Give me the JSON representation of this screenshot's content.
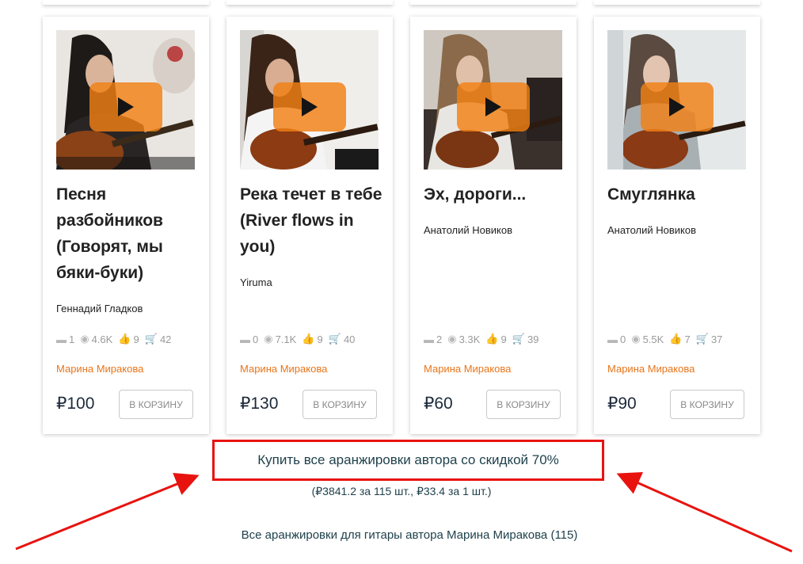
{
  "colors": {
    "accent_orange": "#e8751a",
    "play_overlay": "#f28014",
    "highlight_red": "#e8130f",
    "dark_text": "#1d3f4a"
  },
  "cards": [
    {
      "title": "Песня разбойников (Говорят, мы бяки-буки)",
      "author": "Геннадий Гладков",
      "comments": "1",
      "views": "4.6K",
      "likes": "9",
      "purchases": "42",
      "arranger": "Марина Миракова",
      "price": "₽100",
      "cart_label": "В КОРЗИНУ"
    },
    {
      "title": "Река течет в тебе (River flows in you)",
      "author": "Yiruma",
      "comments": "0",
      "views": "7.1K",
      "likes": "9",
      "purchases": "40",
      "arranger": "Марина Миракова",
      "price": "₽130",
      "cart_label": "В КОРЗИНУ"
    },
    {
      "title": "Эх, дороги...",
      "author": "Анатолий Новиков",
      "comments": "2",
      "views": "3.3K",
      "likes": "9",
      "purchases": "39",
      "arranger": "Марина Миракова",
      "price": "₽60",
      "cart_label": "В КОРЗИНУ"
    },
    {
      "title": "Смуглянка",
      "author": "Анатолий Новиков",
      "comments": "0",
      "views": "5.5K",
      "likes": "7",
      "purchases": "37",
      "arranger": "Марина Миракова",
      "price": "₽90",
      "cart_label": "В КОРЗИНУ"
    }
  ],
  "icons": [
    "comment-icon",
    "eye-icon",
    "thumbs-icon",
    "cart-icon",
    "play-icon"
  ],
  "promo": {
    "label": "Купить все аранжировки автора со скидкой 70%",
    "details": "(₽3841.2 за 115 шт., ₽33.4 за 1 шт.)"
  },
  "all_link": "Все аранжировки для гитары автора Марина Миракова (115)"
}
